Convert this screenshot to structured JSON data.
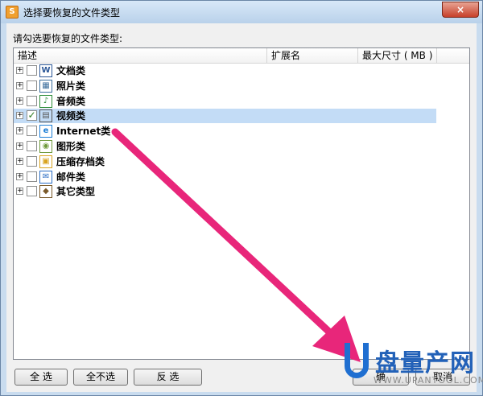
{
  "window": {
    "title": "选择要恢复的文件类型",
    "close_symbol": "×",
    "app_icon_glyph": "S"
  },
  "prompt": "请勾选要恢复的文件类型:",
  "columns": [
    "描述",
    "扩展名",
    "最大尺寸 ( MB )"
  ],
  "items": [
    {
      "label": "文档类",
      "checked": false,
      "icon": "word-document-icon",
      "glyph": "W",
      "color": "#2b5797"
    },
    {
      "label": "照片类",
      "checked": false,
      "icon": "photo-icon",
      "glyph": "▦",
      "color": "#3c6e9c"
    },
    {
      "label": "音频类",
      "checked": false,
      "icon": "audio-icon",
      "glyph": "♪",
      "color": "#2f8f3a"
    },
    {
      "label": "视频类",
      "checked": true,
      "icon": "video-icon",
      "glyph": "▤",
      "color": "#555555"
    },
    {
      "label": "Internet类",
      "checked": false,
      "icon": "internet-explorer-icon",
      "glyph": "e",
      "color": "#1e7fd6"
    },
    {
      "label": "图形类",
      "checked": false,
      "icon": "graphics-icon",
      "glyph": "◉",
      "color": "#6f9a3c"
    },
    {
      "label": "压缩存档类",
      "checked": false,
      "icon": "archive-icon",
      "glyph": "▣",
      "color": "#d9a421"
    },
    {
      "label": "邮件类",
      "checked": false,
      "icon": "mail-icon",
      "glyph": "✉",
      "color": "#2c6ec4"
    },
    {
      "label": "其它类型",
      "checked": false,
      "icon": "other-file-icon",
      "glyph": "◆",
      "color": "#7a5a2a"
    }
  ],
  "buttons": {
    "select_all": "全  选",
    "select_none": "全不选",
    "invert": "反  选",
    "ok": "确",
    "cancel": "取消"
  },
  "watermark": {
    "text": "盘量产网",
    "url": "WWW.UPANTOOL.COM"
  },
  "colors": {
    "selection": "#c3dcf6",
    "arrow": "#e8267a",
    "check": "#2d7a1f"
  }
}
